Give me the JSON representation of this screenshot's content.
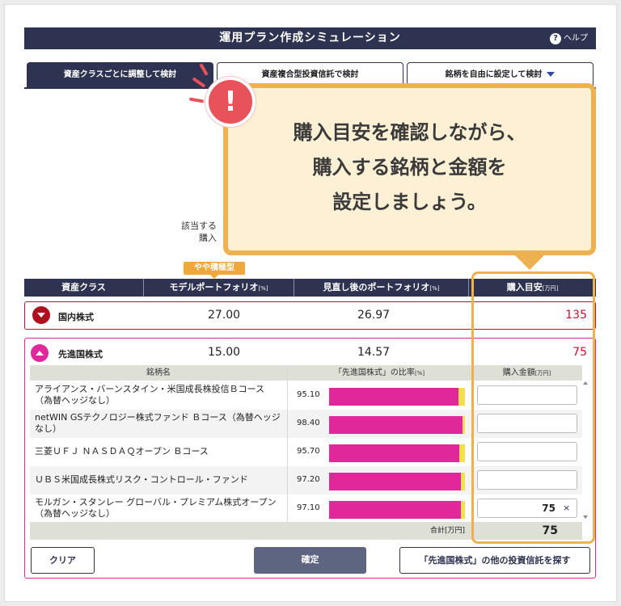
{
  "header": {
    "title": "運用プラン作成シミュレーション",
    "help_label": "ヘルプ",
    "help_icon": "?"
  },
  "tabs": [
    {
      "label": "資産クラスごとに調整して検討",
      "active": true
    },
    {
      "label": "資産複合型投資信託で検討",
      "active": false
    },
    {
      "label": "銘柄を自由に設定して検討",
      "active": false
    }
  ],
  "hint": {
    "line1": "該当する",
    "line2": "購入"
  },
  "callout": {
    "alert_icon": "!",
    "line1": "購入目安を確認しながら、",
    "line2": "購入する銘柄と金額を",
    "line3": "設定しましょう。"
  },
  "badge": "やや積極型",
  "table": {
    "headers": {
      "asset_class": "資産クラス",
      "model": "モデルポートフォリオ",
      "model_unit": "[%]",
      "revised": "見直し後のポートフォリオ",
      "revised_unit": "[%]",
      "guide": "購入目安",
      "guide_unit": "[万円]"
    },
    "rows": [
      {
        "name": "国内株式",
        "model": "27.00",
        "revised": "26.97",
        "guide": "135"
      },
      {
        "name": "先進国株式",
        "model": "15.00",
        "revised": "14.57",
        "guide": "75"
      }
    ]
  },
  "funds": {
    "headers": {
      "name": "銘柄名",
      "ratio": "「先進国株式」の比率",
      "ratio_unit": "[%]",
      "amount": "購入金額",
      "amount_unit": "[万円]"
    },
    "items": [
      {
        "name": "アライアンス・バーンスタイン・米国成長株投信Ｂコース（為替ヘッジなし）",
        "ratio": "95.10",
        "ratio_value": 95.1,
        "amount": ""
      },
      {
        "name": "netWIN GSテクノロジー株式ファンド Ｂコース（為替ヘッジなし）",
        "ratio": "98.40",
        "ratio_value": 98.4,
        "amount": ""
      },
      {
        "name": "三菱ＵＦＪ ＮＡＳＤＡＱオープン Ｂコース",
        "ratio": "95.70",
        "ratio_value": 95.7,
        "amount": ""
      },
      {
        "name": "ＵＢＳ米国成長株式リスク・コントロール・ファンド",
        "ratio": "97.20",
        "ratio_value": 97.2,
        "amount": ""
      },
      {
        "name": "モルガン・スタンレー グローバル・プレミアム株式オープン（為替ヘッジなし）",
        "ratio": "97.10",
        "ratio_value": 97.1,
        "amount": "75"
      }
    ],
    "clear_icon": "×",
    "total_label": "合計",
    "total_unit": "[万円]",
    "total_value": "75"
  },
  "buttons": {
    "clear": "クリア",
    "confirm": "確定",
    "search": "「先進国株式」の他の投資信託を探す"
  },
  "colors": {
    "navy": "#2d3350",
    "pink": "#e0289a",
    "yellow": "#f4e04a",
    "red": "#c8102e",
    "callout_border": "#eeb152"
  }
}
